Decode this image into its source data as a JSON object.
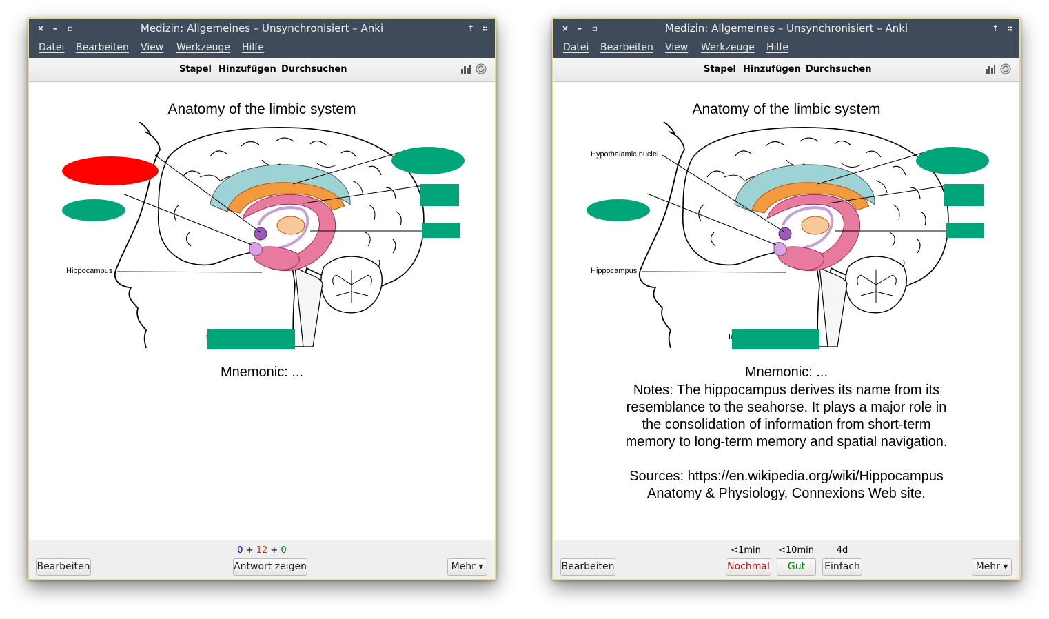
{
  "window": {
    "title": "Medizin: Allgemeines – Unsynchronisiert – Anki",
    "close_glyph": "×",
    "minimize_glyph": "–",
    "maximize_glyph": "▫",
    "up_glyph": "⇡",
    "resize_glyph": "⠶"
  },
  "menu": [
    "Datei",
    "Bearbeiten",
    "View",
    "Werkzeuge",
    "Hilfe"
  ],
  "toolbar": {
    "deck": "Stapel",
    "add": "Hinzufügen",
    "browse": "Durchsuchen",
    "stats_icon": "stats-icon",
    "sync_icon": "sync-icon"
  },
  "card": {
    "title": "Anatomy of the limbic system",
    "labels": {
      "hippocampus": "Hippocampus",
      "hypothalamic": "Hypothalamic nuclei",
      "partial": "In"
    },
    "mnemonic": "Mnemonic: ...",
    "notes": "Notes: The hippocampus derives its name from its resemblance to the seahorse. It plays a major role in the consolidation of information from short-term memory to long-term memory and spatial navigation.",
    "sources_line1": "Sources: https://en.wikipedia.org/wiki/Hippocampus",
    "sources_line2": "Anatomy & Physiology, Connexions Web site.",
    "occlusion_colors": {
      "active": "#ff0000",
      "other": "#00a67a"
    }
  },
  "left": {
    "counts": {
      "new": "0",
      "sep1": "+",
      "learn": "12",
      "sep2": "+",
      "review": "0"
    },
    "edit_button": "Bearbeiten",
    "show_answer_button": "Antwort zeigen",
    "more_button": "Mehr ▾"
  },
  "right": {
    "intervals": [
      "<1min",
      "<10min",
      "4d"
    ],
    "edit_button": "Bearbeiten",
    "again_button": "Nochmal",
    "good_button": "Gut",
    "easy_button": "Einfach",
    "more_button": "Mehr ▾"
  },
  "colors": {
    "titlebar": "#3f4b5b",
    "again": "#cc0000",
    "good": "#008800",
    "new": "#0000cc",
    "learn": "#cc3300",
    "review": "#007700"
  }
}
